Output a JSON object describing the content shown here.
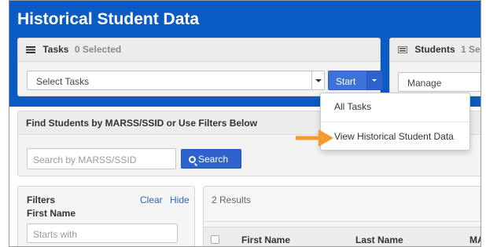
{
  "page": {
    "title": "Historical Student Data"
  },
  "tasks_panel": {
    "icon": "list-icon",
    "title": "Tasks",
    "count": "0 Selected",
    "select_value": "Select Tasks",
    "start_label": "Start"
  },
  "students_panel": {
    "icon": "list-icon",
    "title": "Students",
    "count": "1 Se",
    "select_value": "Manage"
  },
  "dropdown": {
    "items": [
      {
        "label": "All Tasks"
      },
      {
        "label": "View Historical Student Data"
      }
    ],
    "highlight_color": "#f79a2e"
  },
  "find_panel": {
    "title": "Find Students by MARSS/SSID or Use Filters Below",
    "search_placeholder": "Search by MARSS/SSID",
    "search_button": "Search"
  },
  "filters": {
    "title": "Filters",
    "clear": "Clear",
    "hide": "Hide",
    "first_name_label": "First Name",
    "first_name_placeholder": "Starts with"
  },
  "results": {
    "count": "2 Results",
    "columns": [
      "First Name",
      "Last Name",
      "MA"
    ]
  },
  "colors": {
    "banner": "#0a5cc4",
    "primary_button": "#3f72d9",
    "link": "#2e62cc",
    "arrow": "#f79a2e"
  }
}
